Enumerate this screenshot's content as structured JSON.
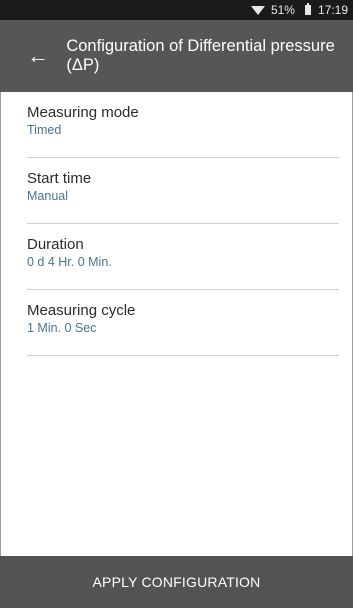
{
  "status_bar": {
    "battery_percent": "51%",
    "time": "17:19",
    "wifi_icon": "wifi-icon",
    "battery_icon": "battery-icon"
  },
  "app_bar": {
    "back_icon": "←",
    "title": "Configuration of Differential pressure (ΔP)"
  },
  "settings": [
    {
      "label": "Measuring mode",
      "value": "Timed"
    },
    {
      "label": "Start time",
      "value": "Manual"
    },
    {
      "label": "Duration",
      "value": "0 d 4 Hr. 0 Min."
    },
    {
      "label": "Measuring cycle",
      "value": "1 Min. 0 Sec"
    }
  ],
  "bottom_bar": {
    "apply_label": "APPLY CONFIGURATION"
  },
  "colors": {
    "app_bar": "#565656",
    "status_bar": "#1a1a1a",
    "value_text": "#4a7590",
    "bottom_bar": "#535353"
  }
}
